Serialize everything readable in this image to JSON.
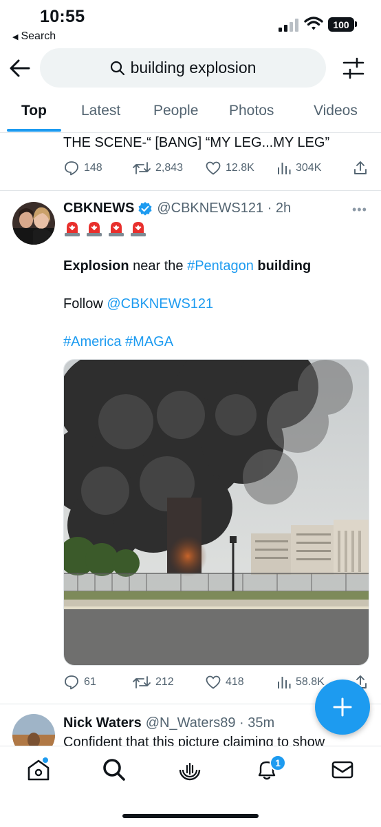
{
  "status_bar": {
    "time": "10:55",
    "back_app": "Search",
    "battery": "100"
  },
  "search": {
    "query": "building explosion",
    "icons": [
      "back-arrow-icon",
      "search-icon",
      "filter-sliders-icon"
    ]
  },
  "tabs": [
    {
      "label": "Top",
      "active": true
    },
    {
      "label": "Latest",
      "active": false
    },
    {
      "label": "People",
      "active": false
    },
    {
      "label": "Photos",
      "active": false
    },
    {
      "label": "Videos",
      "active": false
    }
  ],
  "prev_tweet": {
    "text": "THE SCENE-“ [BANG] “MY LEG...MY LEG”",
    "replies": "148",
    "retweets": "2,843",
    "likes": "12.8K",
    "views": "304K"
  },
  "main_tweet": {
    "display_name": "CBKNEWS",
    "handle_time": "@CBKNEWS121 · 2h",
    "more": "•••",
    "line1_a": "Explosion",
    "line1_b": " near the ",
    "line1_c": "#Pentagon",
    "line1_d": " building",
    "line2_a": "Follow ",
    "line2_b": "@CBKNEWS121",
    "line3_a": "#America",
    "line3_b": "#MAGA",
    "replies": "61",
    "retweets": "212",
    "likes": "418",
    "views": "58.8K"
  },
  "next_tweet": {
    "display_name": "Nick Waters",
    "handle_time": "@N_Waters89 · 35m",
    "text": "Confident that this picture claiming to show"
  },
  "bottom_nav": {
    "items": [
      "home-icon",
      "search-icon",
      "spaces-icon",
      "notifications-icon",
      "messages-icon"
    ],
    "notification_count": "1"
  },
  "colors": {
    "accent": "#1d9bf0",
    "text": "#0f1419",
    "secondary": "#536471"
  }
}
